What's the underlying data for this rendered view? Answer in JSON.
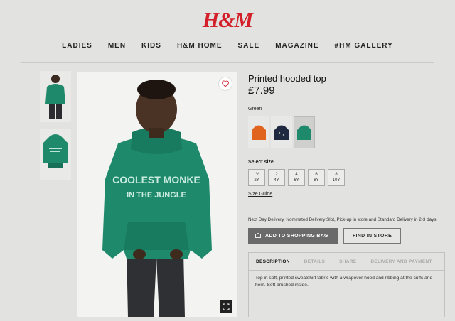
{
  "brand": {
    "logo": "H&M",
    "color": "#d3202a"
  },
  "nav": [
    "LADIES",
    "MEN",
    "KIDS",
    "H&M HOME",
    "SALE",
    "MAGAZINE",
    "#HM GALLERY"
  ],
  "product": {
    "title": "Printed hooded top",
    "price": "£7.99",
    "color_label": "Green",
    "print_text_line1": "COOLEST MONKE",
    "print_text_line2": "IN THE JUNGLE",
    "swatch_colors": [
      "#e0641e",
      "#1f2940",
      "#1f8a6b"
    ],
    "selected_swatch": "Green"
  },
  "sizes": {
    "label": "Select size",
    "options": [
      {
        "top": "1½",
        "bottom": "2Y"
      },
      {
        "top": "2",
        "bottom": "4Y"
      },
      {
        "top": "4",
        "bottom": "6Y"
      },
      {
        "top": "6",
        "bottom": "8Y"
      },
      {
        "top": "8",
        "bottom": "10Y"
      }
    ],
    "guide": "Size Guide"
  },
  "delivery_text": "Next Day Delivery, Nominated Delivery Slot, Pick-up in store and Standard Delivery in 2-3 days.",
  "buttons": {
    "add_to_bag": "ADD TO SHOPPING BAG",
    "find_in_store": "FIND IN STORE"
  },
  "tabs": [
    "DESCRIPTION",
    "DETAILS",
    "SHARE",
    "DELIVERY AND PAYMENT"
  ],
  "description": "Top in soft, printed sweatshirt fabric with a wrapover hood and ribbing at the cuffs and hem. Soft brushed inside.",
  "icons": [
    "heart-icon",
    "expand-icon",
    "bag-icon"
  ]
}
